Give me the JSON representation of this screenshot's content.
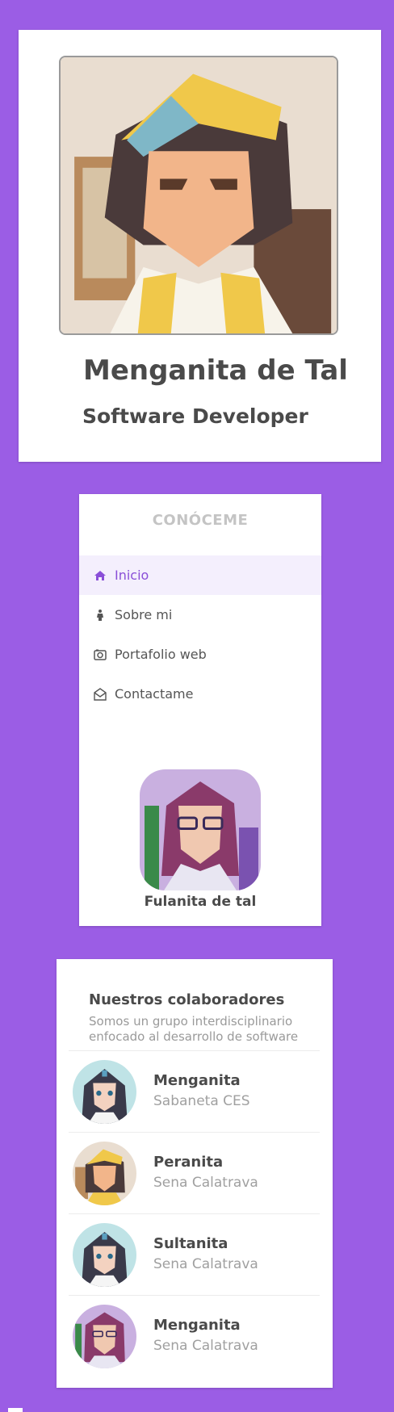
{
  "profile": {
    "name": "Menganita de Tal",
    "role": "Software Developer"
  },
  "menu": {
    "title": "CONÓCEME",
    "items": [
      {
        "label": "Inicio",
        "icon": "home-icon",
        "active": true
      },
      {
        "label": "Sobre mi",
        "icon": "person-icon",
        "active": false
      },
      {
        "label": "Portafolio web",
        "icon": "camera-icon",
        "active": false
      },
      {
        "label": "Contactame",
        "icon": "envelope-icon",
        "active": false
      }
    ],
    "avatar_name": "Fulanita de tal"
  },
  "collaborators": {
    "title": "Nuestros colaboradores",
    "subtitle": "Somos un grupo interdisciplinario enfocado al desarrollo de software",
    "people": [
      {
        "name": "Menganita",
        "place": "Sabaneta CES"
      },
      {
        "name": "Peranita",
        "place": "Sena Calatrava"
      },
      {
        "name": "Sultanita",
        "place": "Sena Calatrava"
      },
      {
        "name": "Menganita",
        "place": "Sena Calatrava"
      }
    ]
  },
  "colors": {
    "background": "#9b5de5",
    "accent": "#8a4fd8",
    "active_bg": "#f4effd"
  }
}
